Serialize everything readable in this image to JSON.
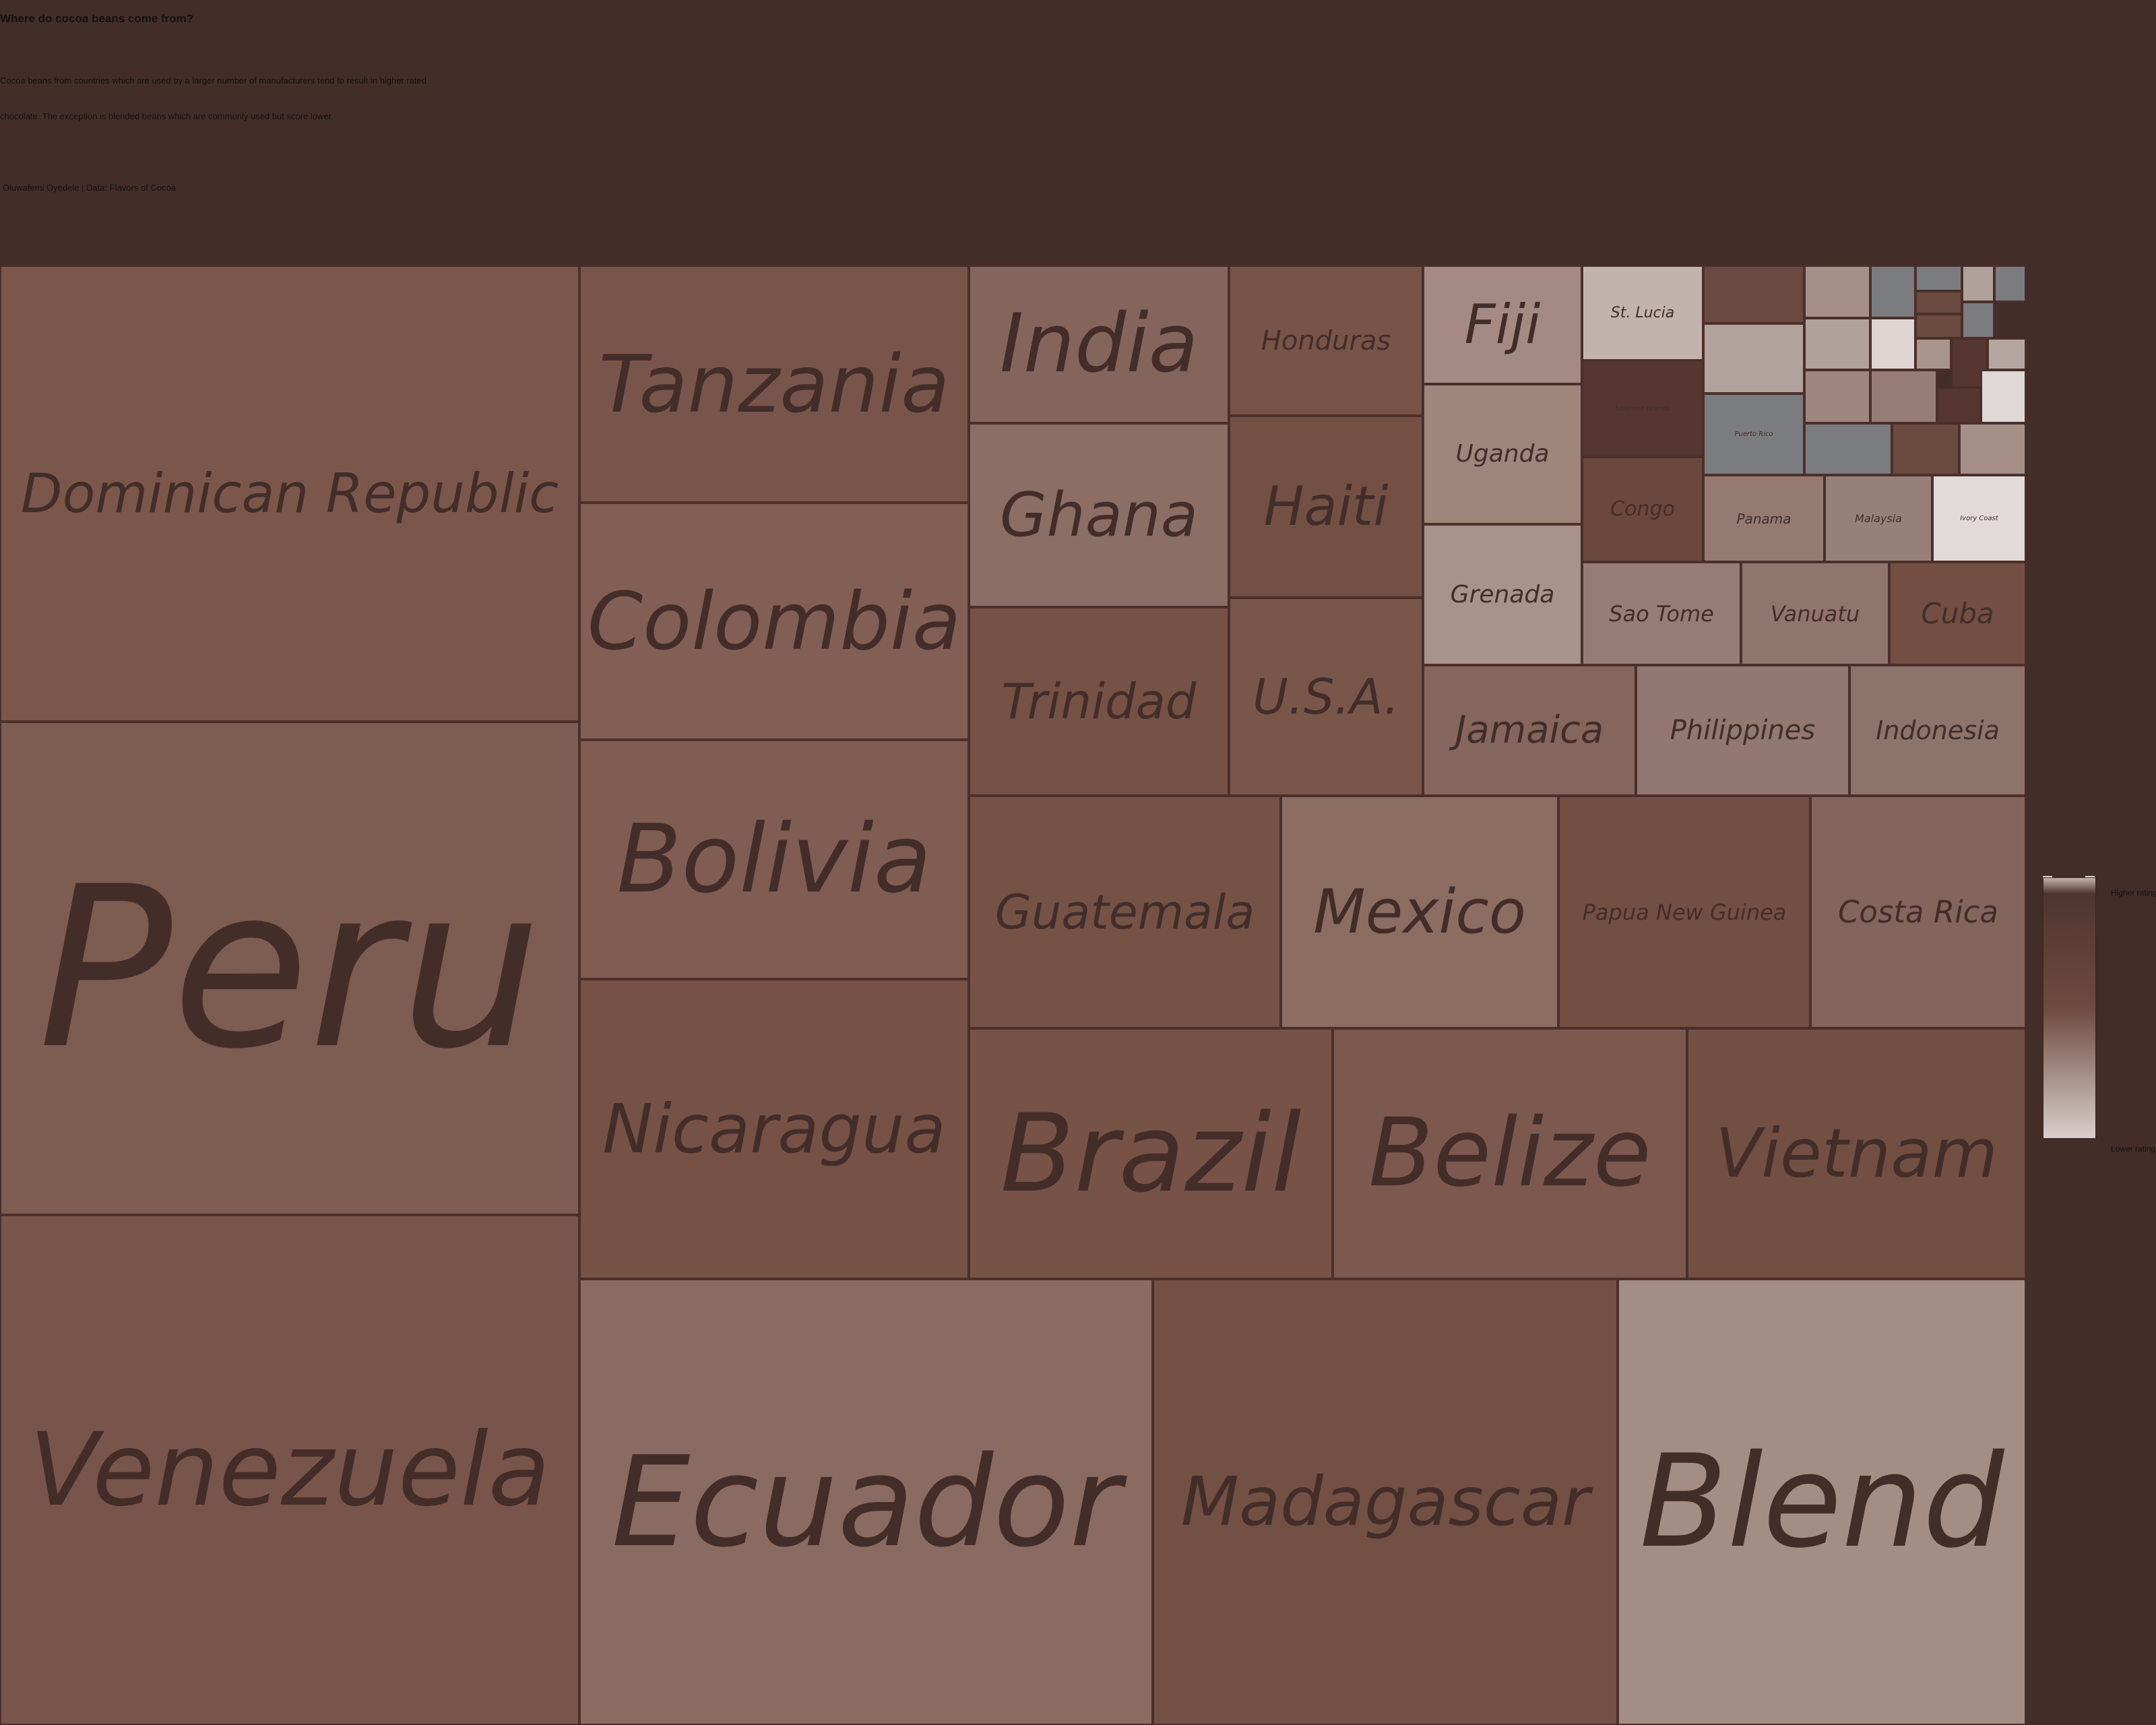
{
  "header": {
    "title": "Where do cocoa beans come from?",
    "subtitle_line1": "Cocoa beans from countries which are used by a larger number of manufacturers tend to result in higher rated",
    "subtitle_line2": "chocolate. The exception is blended beans which are commonly used but score lower.",
    "credit": "Oluwafemi Oyedele | Data: Flavors of Cocoa"
  },
  "legend": {
    "top_label": "Higher rating",
    "bottom_label": "Lower rating",
    "colors": [
      "#c5b2ac",
      "#6e4a40",
      "#d9cfcc"
    ]
  },
  "chart_data": {
    "type": "treemap",
    "title": "Where do cocoa beans come from?",
    "nodes": [
      {
        "name": "Peru",
        "shown_label": "Peru",
        "color": "#7d5c51"
      },
      {
        "name": "Dominican Republic",
        "shown_label": "Dominican Republic",
        "color": "#7b574b"
      },
      {
        "name": "Venezuela",
        "shown_label": "Venezuela",
        "color": "#78554a"
      },
      {
        "name": "Ecuador",
        "shown_label": "Ecuador",
        "color": "#896b61"
      },
      {
        "name": "Madagascar",
        "shown_label": "Madagascar",
        "color": "#735044"
      },
      {
        "name": "Blend",
        "shown_label": "Blend",
        "color": "#a48d85"
      },
      {
        "name": "Tanzania",
        "shown_label": "Tanzania",
        "color": "#78554a"
      },
      {
        "name": "Colombia",
        "shown_label": "Colombia",
        "color": "#815f55"
      },
      {
        "name": "Bolivia",
        "shown_label": "Bolivia",
        "color": "#7f5d53"
      },
      {
        "name": "Nicaragua",
        "shown_label": "Nicaragua",
        "color": "#755245"
      },
      {
        "name": "Brazil",
        "shown_label": "Brazil",
        "color": "#775347"
      },
      {
        "name": "Belize",
        "shown_label": "Belize",
        "color": "#7c594e"
      },
      {
        "name": "Vietnam",
        "shown_label": "Vietnam",
        "color": "#724f43"
      },
      {
        "name": "India",
        "shown_label": "India",
        "color": "#84655b"
      },
      {
        "name": "Ghana",
        "shown_label": "Ghana",
        "color": "#8b6e64"
      },
      {
        "name": "Trinidad",
        "shown_label": "Trinidad",
        "color": "#755146"
      },
      {
        "name": "Honduras",
        "shown_label": "Honduras",
        "color": "#775448"
      },
      {
        "name": "Haiti",
        "shown_label": "Haiti",
        "color": "#725044"
      },
      {
        "name": "U.S.A.",
        "shown_label": "U.S.A.",
        "color": "#78564a"
      },
      {
        "name": "Fiji",
        "shown_label": "Fiji",
        "color": "#a48a82"
      },
      {
        "name": "Uganda",
        "shown_label": "Uganda",
        "color": "#9f857c"
      },
      {
        "name": "Grenada",
        "shown_label": "Grenada",
        "color": "#a8928a"
      },
      {
        "name": "Guatemala",
        "shown_label": "Guatemala",
        "color": "#755246"
      },
      {
        "name": "Mexico",
        "shown_label": "Mexico",
        "color": "#8b6d62"
      },
      {
        "name": "Papua New Guinea",
        "shown_label": "Papua New Guinea",
        "color": "#724f43"
      },
      {
        "name": "Costa Rica",
        "shown_label": "Costa Rica",
        "color": "#84655b"
      },
      {
        "name": "Jamaica",
        "shown_label": "Jamaica",
        "color": "#85665c"
      },
      {
        "name": "Philippines",
        "shown_label": "Philippines",
        "color": "#927870"
      },
      {
        "name": "Indonesia",
        "shown_label": "Indonesia",
        "color": "#8e736a"
      },
      {
        "name": "Sao Tome",
        "shown_label": "Sao Tome",
        "color": "#967c74"
      },
      {
        "name": "Vanuatu",
        "shown_label": "Vanuatu",
        "color": "#8f756c"
      },
      {
        "name": "Cuba",
        "shown_label": "Cuba",
        "color": "#734f43"
      },
      {
        "name": "Congo",
        "shown_label": "Congo",
        "color": "#6b483d"
      },
      {
        "name": "St. Lucia",
        "shown_label": "St. Lucia",
        "color": "#c2b3ae"
      },
      {
        "name": "Panama",
        "shown_label": "Panama",
        "color": "#947a71"
      },
      {
        "name": "Malaysia",
        "shown_label": "Malaysia",
        "color": "#98807a"
      },
      {
        "name": "Ivory Coast",
        "shown_label": "Ivory Coast",
        "color": "#e2dad8"
      },
      {
        "name": "Puerto Rico",
        "shown_label": "Puerto Rico",
        "color": "#7b7c7f"
      },
      {
        "name": "Solomon Islands",
        "shown_label": "Solomon Islands",
        "color": "#553631"
      },
      {
        "name": "",
        "shown_label": "",
        "color": "#6a4a40"
      },
      {
        "name": "",
        "shown_label": "",
        "color": "#a68f88"
      },
      {
        "name": "",
        "shown_label": "",
        "color": "#7b7c7f"
      },
      {
        "name": "",
        "shown_label": "",
        "color": "#7b7c7f"
      },
      {
        "name": "",
        "shown_label": "",
        "color": "#b1a19d"
      },
      {
        "name": "",
        "shown_label": "",
        "color": "#7b7c7f"
      },
      {
        "name": "",
        "shown_label": "",
        "color": "#6b4a40"
      },
      {
        "name": "",
        "shown_label": "",
        "color": "#b2a29d"
      },
      {
        "name": "",
        "shown_label": "",
        "color": "#7b7c7f"
      },
      {
        "name": "",
        "shown_label": "",
        "color": "#6b4a40"
      },
      {
        "name": "",
        "shown_label": "",
        "color": "#b1a19d"
      },
      {
        "name": "",
        "shown_label": "",
        "color": "#dfd6d4"
      },
      {
        "name": "",
        "shown_label": "",
        "color": "#aa948e"
      },
      {
        "name": "",
        "shown_label": "",
        "color": "#553631"
      },
      {
        "name": "",
        "shown_label": "",
        "color": "#b5a6a2"
      },
      {
        "name": "",
        "shown_label": "",
        "color": "#9f8680"
      },
      {
        "name": "",
        "shown_label": "",
        "color": "#967e77"
      },
      {
        "name": "",
        "shown_label": "",
        "color": "#553631"
      },
      {
        "name": "",
        "shown_label": "",
        "color": "#e0d8d6"
      },
      {
        "name": "",
        "shown_label": "",
        "color": "#7b7c7f"
      },
      {
        "name": "",
        "shown_label": "",
        "color": "#6b4a40"
      },
      {
        "name": "",
        "shown_label": "",
        "color": "#a68f88"
      }
    ]
  }
}
